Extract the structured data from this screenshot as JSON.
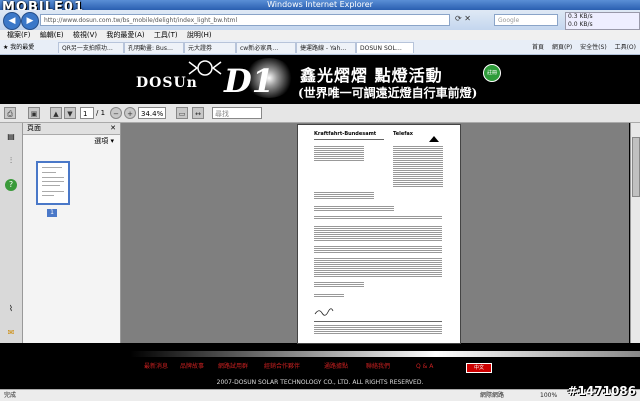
{
  "window": {
    "title": "Windows Internet Explorer",
    "logo_overlay": "MOBILE01"
  },
  "address": {
    "url": "http://www.dosun.com.tw/bs_mobile/delight/index_light_bw.html",
    "search_placeholder": "Google",
    "net_down": "0.3 KB/s",
    "net_up": "0.0 KB/s"
  },
  "menu": [
    "檔案(F)",
    "編輯(E)",
    "檢視(V)",
    "我的最愛(A)",
    "工具(T)",
    "說明(H)"
  ],
  "favorites": {
    "label": "我的最愛"
  },
  "tabs": [
    "QR另一支拍照功…",
    "孔明動畫: Bus…",
    "元大證券",
    "cw新必家具…",
    "捷運路線 - Yah…",
    "DOSUN SOL…"
  ],
  "tools": [
    "首頁",
    "網頁(P)",
    "安全性(S)",
    "工具(O)"
  ],
  "banner": {
    "brand": "DOSUN",
    "brand_mark": "DOSUn",
    "model": "D1",
    "headline": "鑫光熠熠 點燈活動",
    "subline": "(世界唯一可調遠近燈自行車前燈)",
    "emblem": "註冊"
  },
  "pdf": {
    "page_current": "1",
    "page_total": "/ 1",
    "zoom": "34.4%",
    "find_placeholder": "尋找",
    "panel_title": "頁面",
    "panel_options": "選項 ▾",
    "thumb_label": "1"
  },
  "doc": {
    "header": "Kraftfahrt-Bundesamt",
    "doctype": "Telefax"
  },
  "footer": {
    "links": [
      "最新消息",
      "品牌故事",
      "網路試用群",
      "經銷合作夥伴",
      "通路據點",
      "聯絡我們",
      "Q & A"
    ],
    "flag": "中文",
    "copyright": "2007-DOSUN SOLAR TECHNOLOGY CO., LTD. ALL RIGHTS RESERVED."
  },
  "status": {
    "left": "完成",
    "zone": "網際網路",
    "zoom": "100%"
  },
  "watermark": "#1471086",
  "colors": {
    "accent": "#2a5fb0",
    "footer_link": "#c82020",
    "banner_bg": "#000000"
  }
}
